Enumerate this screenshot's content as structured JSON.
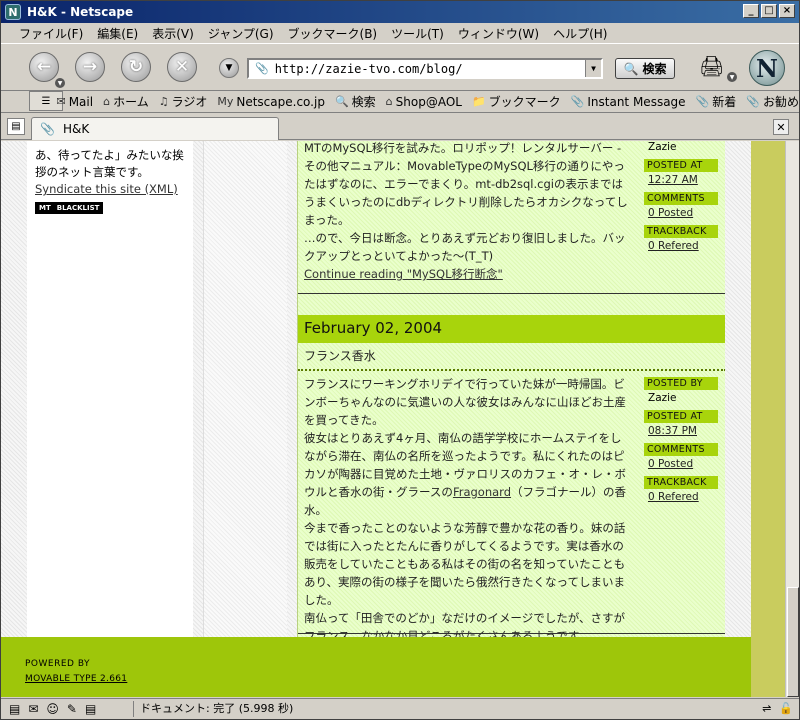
{
  "window": {
    "title": "H&K - Netscape",
    "app_icon": "N",
    "min": "_",
    "max": "□",
    "close": "×"
  },
  "menu": [
    "ファイル(F)",
    "編集(E)",
    "表示(V)",
    "ジャンプ(G)",
    "ブックマーク(B)",
    "ツール(T)",
    "ウィンドウ(W)",
    "ヘルプ(H)"
  ],
  "nav": {
    "url": "http://zazie-tvo.com/blog/",
    "search_label": "検索"
  },
  "personal_toolbar": [
    {
      "icon": "mail-icon",
      "label": "Mail"
    },
    {
      "icon": "home-icon",
      "label": "ホーム"
    },
    {
      "icon": "radio-icon",
      "label": "ラジオ"
    },
    {
      "icon": "my-icon",
      "label": "Netscape.co.jp"
    },
    {
      "icon": "search-icon",
      "label": "検索"
    },
    {
      "icon": "aol-icon",
      "label": "Shop@AOL"
    },
    {
      "icon": "folder-icon",
      "label": "ブックマーク"
    },
    {
      "icon": "im-icon",
      "label": "Instant Message"
    },
    {
      "icon": "bookmark-icon",
      "label": "新着"
    },
    {
      "icon": "bookmark-icon",
      "label": "お勧め"
    }
  ],
  "tab": {
    "title": "H&K"
  },
  "sidebar": {
    "text": "あ、待ってたよ」みたいな挨拶のネット言葉です。",
    "syndicate": "Syndicate this site (XML)",
    "badge_left": "MT",
    "badge_right": "BLACKLIST"
  },
  "entry1": {
    "text_before": "MTのMySQL移行を試みた。ロリポップ！レンタルサーバー - その他マニュアル",
    "text_middle": "：MovableTypeのMySQL移行の通りにやったはずなのに、エラーでまくり。mt-db2sql.cgiの表示まではうまくいったのにdbディレクトリ削除したらオカシクなってしまった。",
    "text_after": "…ので、今日は断念。とりあえず元どおり復旧しました。バックアップとっといてよかった～(T_T)",
    "continue": "Continue reading \"MySQL移行断念\"",
    "author": "Zazie",
    "posted_at_label": "POSTED AT",
    "posted_at": "12:27 AM",
    "comments_label": "COMMENTS",
    "comments": "0 Posted",
    "trackback_label": "TRACKBACK",
    "trackback": "0 Refered"
  },
  "entry2": {
    "date": "February 02, 2004",
    "title": "フランス香水",
    "p1": "フランスにワーキングホリデイで行っていた妹が一時帰国。ビンボーちゃんなのに気遣いの人な彼女はみんなに山ほどお土産を買ってきた。",
    "p2a": "彼女はとりあえず4ヶ月、南仏の語学学校にホームステイをしながら滞在、南仏の名所を巡ったようです。私にくれたのはピカソが陶器に目覚めた土地・ヴァロリスのカフェ・オ・レ・ボウルと香水の街・グラースの",
    "p2link": "Fragonard",
    "p2b": "（フラゴナール）の香水。",
    "p3": "今まで香ったことのないような芳醇で豊かな花の香り。妹の話では街に入ったとたんに香りがしてくるようです。実は香水の販売をしていたこともある私はその街の名を知っていたこともあり、実際の街の様子を聞いたら俄然行きたくなってしまいました。",
    "p4": "南仏って「田舎でのどか」なだけのイメージでしたが、さすがフランス、なかなか見どころがたくさんあるようです。",
    "posted_by_label": "POSTED BY",
    "author": "Zazie",
    "posted_at_label": "POSTED AT",
    "posted_at": "08:37 PM",
    "comments_label": "COMMENTS",
    "comments": "0 Posted",
    "trackback_label": "TRACKBACK",
    "trackback": "0 Refered"
  },
  "footer": {
    "powered_by": "POWERED BY",
    "link": "MOVABLE TYPE 2.661"
  },
  "status": {
    "text": "ドキュメント: 完了 (5.998 秒)"
  },
  "colors": {
    "accent": "#a8d40c",
    "footer": "#9ec60a",
    "olive": "#c9cc5e",
    "title_bar": "#0a246a"
  }
}
